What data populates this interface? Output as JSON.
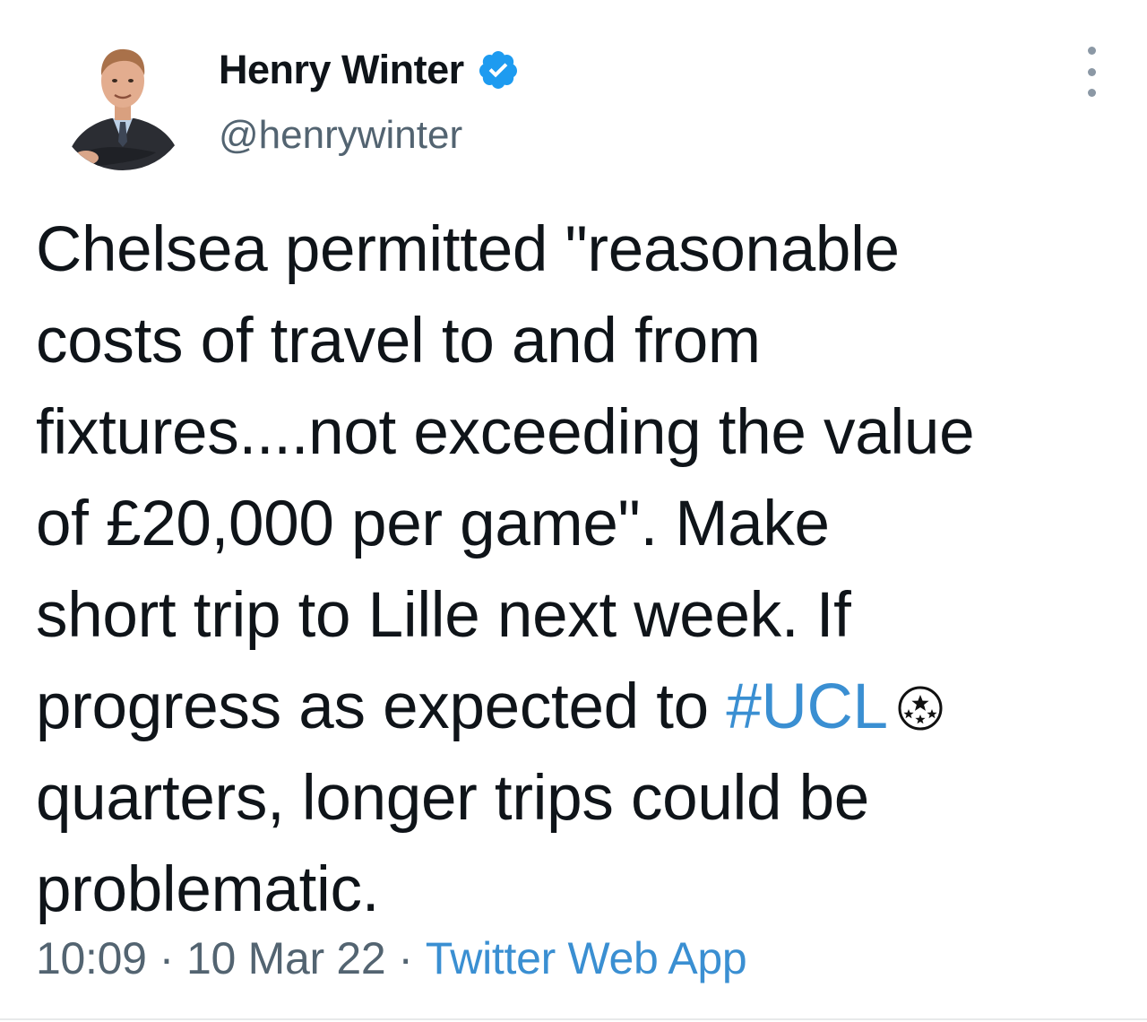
{
  "author": {
    "display_name": "Henry Winter",
    "handle": "@henrywinter",
    "verified": true
  },
  "tweet": {
    "lines": [
      "Chelsea permitted \"reasonable",
      "costs of travel to and from",
      "fixtures....not exceeding the value",
      "of £20,000 per game\". Make",
      "short trip to Lille next week. If"
    ],
    "line6_prefix": "progress as expected to ",
    "hashtag": "#UCL",
    "lines_after": [
      "quarters, longer trips could be",
      "problematic."
    ]
  },
  "meta": {
    "time": "10:09",
    "separator": "·",
    "date": "10 Mar 22",
    "source": "Twitter Web App"
  },
  "colors": {
    "link": "#3a8fd2",
    "verified_badge": "#1d9bf0",
    "text": "#0f1419",
    "secondary": "#536471"
  },
  "icons": {
    "verified": "verified-badge-icon",
    "more": "more-options-icon",
    "hashtag_emoji": "champions-league-starball-icon"
  }
}
